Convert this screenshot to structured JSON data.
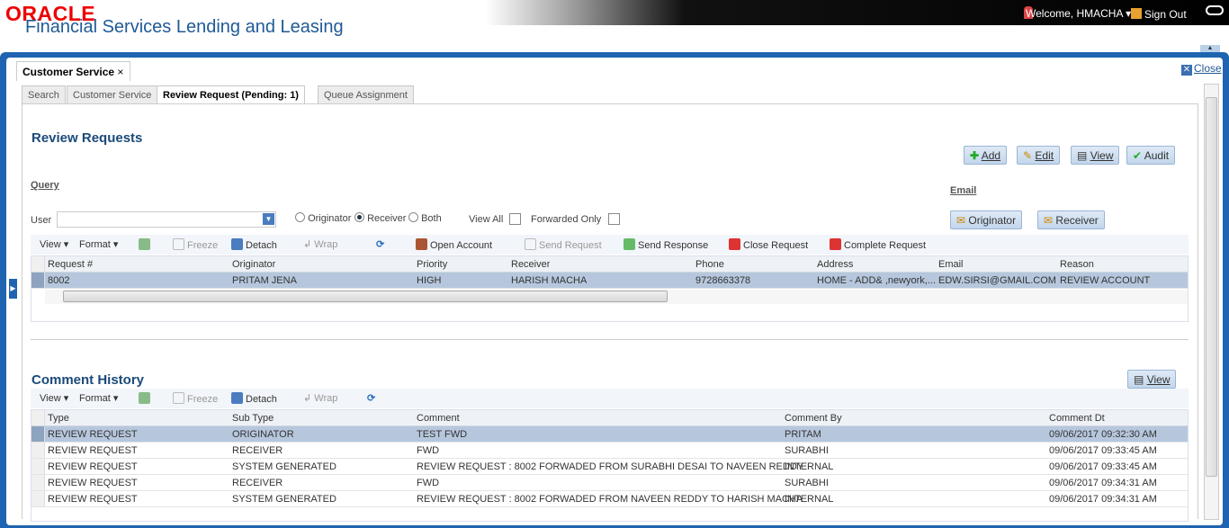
{
  "header": {
    "logo": "ORACLE",
    "app_title": "Financial Services Lending and Leasing",
    "welcome": "Welcome, HMACHA",
    "sign_out": "Sign Out"
  },
  "main_tab": {
    "label": "Customer Service",
    "close_label": "Close"
  },
  "sub_tabs": [
    "Search",
    "Customer Service",
    "Review Request (Pending: 1)",
    "Queue Assignment"
  ],
  "review": {
    "title": "Review Requests",
    "buttons": {
      "add": "Add",
      "edit": "Edit",
      "view": "View",
      "audit": "Audit"
    },
    "query_label": "Query",
    "user_label": "User",
    "user_value": "",
    "radio": {
      "originator": "Originator",
      "receiver": "Receiver",
      "both": "Both",
      "selected": "Receiver"
    },
    "view_all": "View All",
    "forwarded_only": "Forwarded Only",
    "email_label": "Email",
    "email_buttons": {
      "originator": "Originator",
      "receiver": "Receiver"
    }
  },
  "toolbar": {
    "view": "View",
    "format": "Format",
    "freeze": "Freeze",
    "detach": "Detach",
    "wrap": "Wrap",
    "open_account": "Open Account",
    "send_request": "Send Request",
    "send_response": "Send Response",
    "close_request": "Close Request",
    "complete_request": "Complete Request"
  },
  "requests": {
    "columns": [
      "Request #",
      "Originator",
      "Priority",
      "Receiver",
      "Phone",
      "Address",
      "Email",
      "Reason"
    ],
    "rows": [
      [
        "8002",
        "PRITAM JENA",
        "HIGH",
        "HARISH MACHA",
        "9728663378",
        "HOME - ADD& ,newyork,...",
        "EDW.SIRSI@GMAIL.COM",
        "REVIEW ACCOUNT"
      ]
    ]
  },
  "comments": {
    "title": "Comment History",
    "view_button": "View",
    "columns": [
      "Type",
      "Sub Type",
      "Comment",
      "Comment By",
      "Comment Dt"
    ],
    "rows": [
      [
        "REVIEW REQUEST",
        "ORIGINATOR",
        "TEST FWD",
        "PRITAM",
        "09/06/2017 09:32:30 AM"
      ],
      [
        "REVIEW REQUEST",
        "RECEIVER",
        "FWD",
        "SURABHI",
        "09/06/2017 09:33:45 AM"
      ],
      [
        "REVIEW REQUEST",
        "SYSTEM GENERATED",
        "REVIEW REQUEST : 8002 FORWADED FROM SURABHI DESAI TO NAVEEN REDDY",
        "INTERNAL",
        "09/06/2017 09:33:45 AM"
      ],
      [
        "REVIEW REQUEST",
        "RECEIVER",
        "FWD",
        "SURABHI",
        "09/06/2017 09:34:31 AM"
      ],
      [
        "REVIEW REQUEST",
        "SYSTEM GENERATED",
        "REVIEW REQUEST : 8002 FORWADED FROM NAVEEN REDDY TO HARISH MACHA",
        "INTERNAL",
        "09/06/2017 09:34:31 AM"
      ]
    ]
  }
}
